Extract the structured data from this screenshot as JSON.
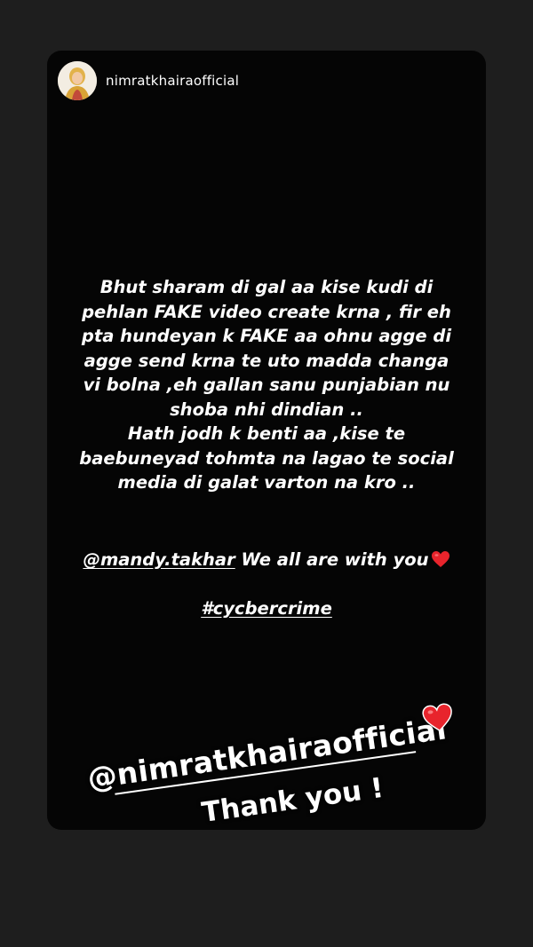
{
  "story": {
    "username": "nimratkhairaofficial",
    "avatar_icon": "profile-avatar",
    "body_lines": [
      "Bhut sharam di gal aa kise kudi di",
      "pehlan FAKE video create krna , fir eh",
      "pta hundeyan k FAKE aa ohnu agge di",
      "agge send krna te uto madda changa",
      "vi bolna ,eh gallan sanu punjabian nu",
      "shoba nhi dindian ..",
      "Hath jodh k benti aa ,kise te",
      "baebuneyad tohmta na lagao te social",
      "media di galat varton na kro .."
    ],
    "mention": "@mandy.takhar",
    "mention_suffix": " We all are with you",
    "hashtag": "#cycbercrime",
    "heart_icon": "red-heart-icon",
    "heart_color": "#e8242c"
  },
  "overlay": {
    "mention": "@nimratkhairaofficial",
    "thanks": "Thank you !"
  },
  "colors": {
    "background": "#1e1e1e",
    "card": "#050505",
    "text": "#ffffff"
  }
}
